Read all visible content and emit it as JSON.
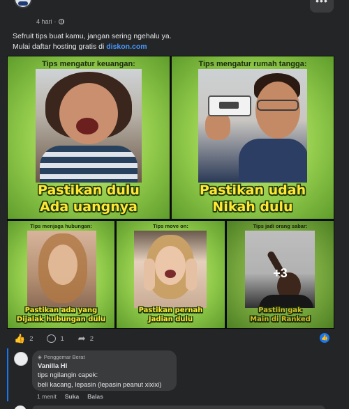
{
  "post": {
    "time": "4 hari",
    "dot": "·",
    "more_label": "•••",
    "text_line1": "Sefruit tips buat kamu, jangan sering ngehalu ya.",
    "text_line2_prefix": "Mulai daftar hosting gratis di ",
    "text_link": "diskon.com"
  },
  "memes": {
    "p1": {
      "title": "Tips mengatur keuangan:",
      "caption1": "Pastikan dulu",
      "caption2": "Ada uangnya"
    },
    "p2": {
      "title": "Tips mengatur rumah tangga:",
      "caption1": "Pastikan udah",
      "caption2": "Nikah dulu"
    },
    "p3": {
      "title": "Tips menjaga hubungan:",
      "caption1": "Pastikan ada yang",
      "caption2": "Dijalak hubungan dulu"
    },
    "p4": {
      "title": "Tips move on:",
      "caption1": "Pastikan pernah",
      "caption2": "Jadian dulu"
    },
    "p5": {
      "title": "Tips jadi orang sabar:",
      "caption1": "Pastiin gak",
      "caption2": "Main di Ranked",
      "more": "+3"
    }
  },
  "stats": {
    "likes": "2",
    "comments": "1",
    "shares": "2"
  },
  "comment": {
    "badge": "Penggemar Berat",
    "author": "Vanilla HI",
    "line1": "tips ngilangin capek:",
    "line2": "beli kacang, lepasin (lepasin peanut xixixi)",
    "time": "1 menit",
    "like": "Suka",
    "reply": "Balas"
  },
  "colors": {
    "accent": "#1877f2",
    "link": "#4599ff",
    "caption": "#ffe733",
    "panel": "#93cc4c"
  }
}
